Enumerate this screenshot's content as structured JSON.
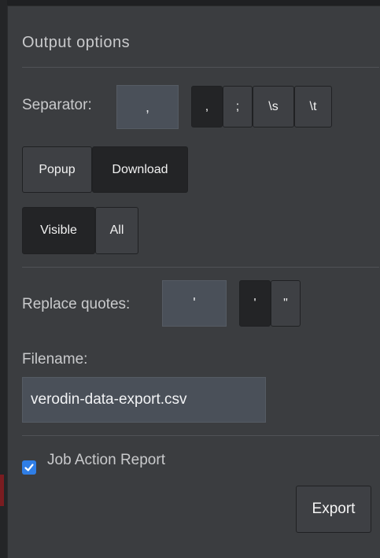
{
  "panel": {
    "title": "Output options"
  },
  "separator": {
    "label": "Separator:",
    "current_value": ",",
    "options": [
      ",",
      ";",
      "\\s",
      "\\t"
    ],
    "selected": ","
  },
  "destination": {
    "options": [
      "Popup",
      "Download"
    ],
    "selected": "Download"
  },
  "rows": {
    "options": [
      "Visible",
      "All"
    ],
    "selected": "Visible"
  },
  "quotes": {
    "label": "Replace quotes:",
    "current_value": "'",
    "options": [
      "'",
      "\""
    ],
    "selected": "'"
  },
  "filename": {
    "label": "Filename:",
    "value": "verodin-data-export.csv"
  },
  "job_action_report": {
    "label": "Job Action Report",
    "checked": true
  },
  "export_label": "Export",
  "colors": {
    "accent": "#2f7ee6",
    "background": "#3b3d40",
    "active_button": "#232426"
  }
}
